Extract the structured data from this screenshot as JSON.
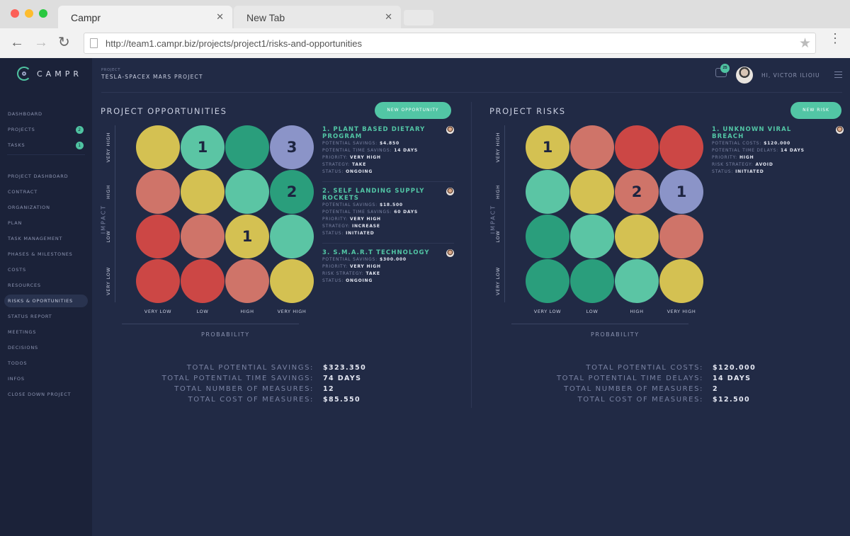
{
  "browser": {
    "tabs": [
      {
        "label": "Campr",
        "close": "✕"
      },
      {
        "label": "New Tab",
        "close": "✕"
      }
    ],
    "url": "http://team1.campr.biz/projects/project1/risks-and-opportunities",
    "icons": {
      "back": "←",
      "forward": "→",
      "reload": "↻",
      "star": "★",
      "menu": "⋮"
    }
  },
  "logo": {
    "text": "CAMPR"
  },
  "sidebar": {
    "items": [
      {
        "label": "DASHBOARD",
        "badge": ""
      },
      {
        "label": "PROJECTS",
        "badge": "2"
      },
      {
        "label": "TASKS",
        "badge": "1"
      },
      {
        "label": "PROJECT DASHBOARD",
        "badge": ""
      },
      {
        "label": "CONTRACT",
        "badge": ""
      },
      {
        "label": "ORGANIZATION",
        "badge": ""
      },
      {
        "label": "PLAN",
        "badge": ""
      },
      {
        "label": "TASK MANAGEMENT",
        "badge": ""
      },
      {
        "label": "PHASES & MILESTONES",
        "badge": ""
      },
      {
        "label": "COSTS",
        "badge": ""
      },
      {
        "label": "RESOURCES",
        "badge": ""
      },
      {
        "label": "RISKS & OPORTUNITIES",
        "badge": "",
        "active": true
      },
      {
        "label": "STATUS REPORT",
        "badge": ""
      },
      {
        "label": "MEETINGS",
        "badge": ""
      },
      {
        "label": "DECISIONS",
        "badge": ""
      },
      {
        "label": "TODOS",
        "badge": ""
      },
      {
        "label": "INFOS",
        "badge": ""
      },
      {
        "label": "CLOSE DOWN PROJECT",
        "badge": ""
      }
    ]
  },
  "header": {
    "project_label": "PROJECT",
    "project_name": "TESLA-SPACEX MARS PROJECT",
    "messages_badge": "25",
    "greeting": "HI, VICTOR ILIOIU"
  },
  "colors": {
    "yellow": "#d4c152",
    "salmon": "#cf7469",
    "red": "#cc4745",
    "mint": "#5bc5a4",
    "green": "#2a9e7c",
    "lavender": "#8b94c8",
    "accent": "#52c6a5"
  },
  "opportunities": {
    "title": "PROJECT OPPORTUNITIES",
    "button": "NEW OPPORTUNITY",
    "impact_label": "IMPACT",
    "probability_label": "PROBABILITY",
    "y_labels": [
      "VERY HIGH",
      "HIGH",
      "LOW",
      "VERY LOW"
    ],
    "x_labels": [
      "VERY LOW",
      "LOW",
      "HIGH",
      "VERY HIGH"
    ],
    "grid": [
      [
        {
          "color": "yellow",
          "count": ""
        },
        {
          "color": "mint",
          "count": "1"
        },
        {
          "color": "green",
          "count": ""
        },
        {
          "color": "lavender",
          "count": "3",
          "cursor": true
        }
      ],
      [
        {
          "color": "salmon",
          "count": ""
        },
        {
          "color": "yellow",
          "count": ""
        },
        {
          "color": "mint",
          "count": ""
        },
        {
          "color": "green",
          "count": "2"
        }
      ],
      [
        {
          "color": "red",
          "count": ""
        },
        {
          "color": "salmon",
          "count": ""
        },
        {
          "color": "yellow",
          "count": "1"
        },
        {
          "color": "mint",
          "count": ""
        }
      ],
      [
        {
          "color": "red",
          "count": ""
        },
        {
          "color": "red",
          "count": ""
        },
        {
          "color": "salmon",
          "count": ""
        },
        {
          "color": "yellow",
          "count": ""
        }
      ]
    ],
    "items": [
      {
        "title": "1. PLANT BASED DIETARY PROGRAM",
        "fields": [
          {
            "k": "POTENTIAL SAVINGS:",
            "v": "$4.850"
          },
          {
            "k": "POTENTIAL TIME SAVINGS:",
            "v": "14 DAYS"
          },
          {
            "k": "PRIORITY:",
            "v": "VERY HIGH"
          },
          {
            "k": "STRATEGY:",
            "v": "TAKE"
          },
          {
            "k": "STATUS:",
            "v": "ONGOING"
          }
        ]
      },
      {
        "title": "2. SELF LANDING SUPPLY ROCKETS",
        "fields": [
          {
            "k": "POTENTIAL SAVINGS:",
            "v": "$18.500"
          },
          {
            "k": "POTENTIAL TIME SAVINGS:",
            "v": "60 DAYS"
          },
          {
            "k": "PRIORITY:",
            "v": "VERY HIGH"
          },
          {
            "k": "STRATEGY:",
            "v": "INCREASE"
          },
          {
            "k": "STATUS:",
            "v": "INITIATED"
          }
        ]
      },
      {
        "title": "3. S.M.A.R.T TECHNOLOGY",
        "fields": [
          {
            "k": "POTENTIAL SAVINGS:",
            "v": "$300.000"
          },
          {
            "k": "PRIORITY:",
            "v": "VERY HIGH"
          },
          {
            "k": "RISK STRATEGY:",
            "v": "TAKE"
          },
          {
            "k": "STATUS:",
            "v": "ONGOING"
          }
        ]
      }
    ],
    "totals": [
      {
        "label": "TOTAL POTENTIAL SAVINGS:",
        "value": "$323.350"
      },
      {
        "label": "TOTAL POTENTIAL TIME SAVINGS:",
        "value": "74 DAYS"
      },
      {
        "label": "TOTAL NUMBER OF MEASURES:",
        "value": "12"
      },
      {
        "label": "TOTAL COST OF MEASURES:",
        "value": "$85.550"
      }
    ]
  },
  "risks": {
    "title": "PROJECT RISKS",
    "button": "NEW RISK",
    "impact_label": "IMPACT",
    "probability_label": "PROBABILITY",
    "y_labels": [
      "VERY HIGH",
      "HIGH",
      "LOW",
      "VERY LOW"
    ],
    "x_labels": [
      "VERY LOW",
      "LOW",
      "HIGH",
      "VERY HIGH"
    ],
    "grid": [
      [
        {
          "color": "yellow",
          "count": "1"
        },
        {
          "color": "salmon",
          "count": ""
        },
        {
          "color": "red",
          "count": ""
        },
        {
          "color": "red",
          "count": ""
        }
      ],
      [
        {
          "color": "mint",
          "count": ""
        },
        {
          "color": "yellow",
          "count": ""
        },
        {
          "color": "salmon",
          "count": "2"
        },
        {
          "color": "lavender",
          "count": "1",
          "cursor": true
        }
      ],
      [
        {
          "color": "green",
          "count": ""
        },
        {
          "color": "mint",
          "count": ""
        },
        {
          "color": "yellow",
          "count": ""
        },
        {
          "color": "salmon",
          "count": ""
        }
      ],
      [
        {
          "color": "green",
          "count": ""
        },
        {
          "color": "green",
          "count": ""
        },
        {
          "color": "mint",
          "count": ""
        },
        {
          "color": "yellow",
          "count": ""
        }
      ]
    ],
    "items": [
      {
        "title": "1. UNKNOWN VIRAL BREACH",
        "fields": [
          {
            "k": "POTENTIAL COSTS:",
            "v": "$120.000"
          },
          {
            "k": "POTENTIAL TIME DELAYS:",
            "v": "14 DAYS"
          },
          {
            "k": "PRIORITY:",
            "v": "HIGH"
          },
          {
            "k": "RISK STRATEGY:",
            "v": "AVOID"
          },
          {
            "k": "STATUS:",
            "v": "INITIATED"
          }
        ]
      }
    ],
    "totals": [
      {
        "label": "TOTAL POTENTIAL COSTS:",
        "value": "$120.000"
      },
      {
        "label": "TOTAL POTENTIAL TIME DELAYS:",
        "value": "14 DAYS"
      },
      {
        "label": "TOTAL NUMBER OF MEASURES:",
        "value": "2"
      },
      {
        "label": "TOTAL COST OF MEASURES:",
        "value": "$12.500"
      }
    ]
  }
}
